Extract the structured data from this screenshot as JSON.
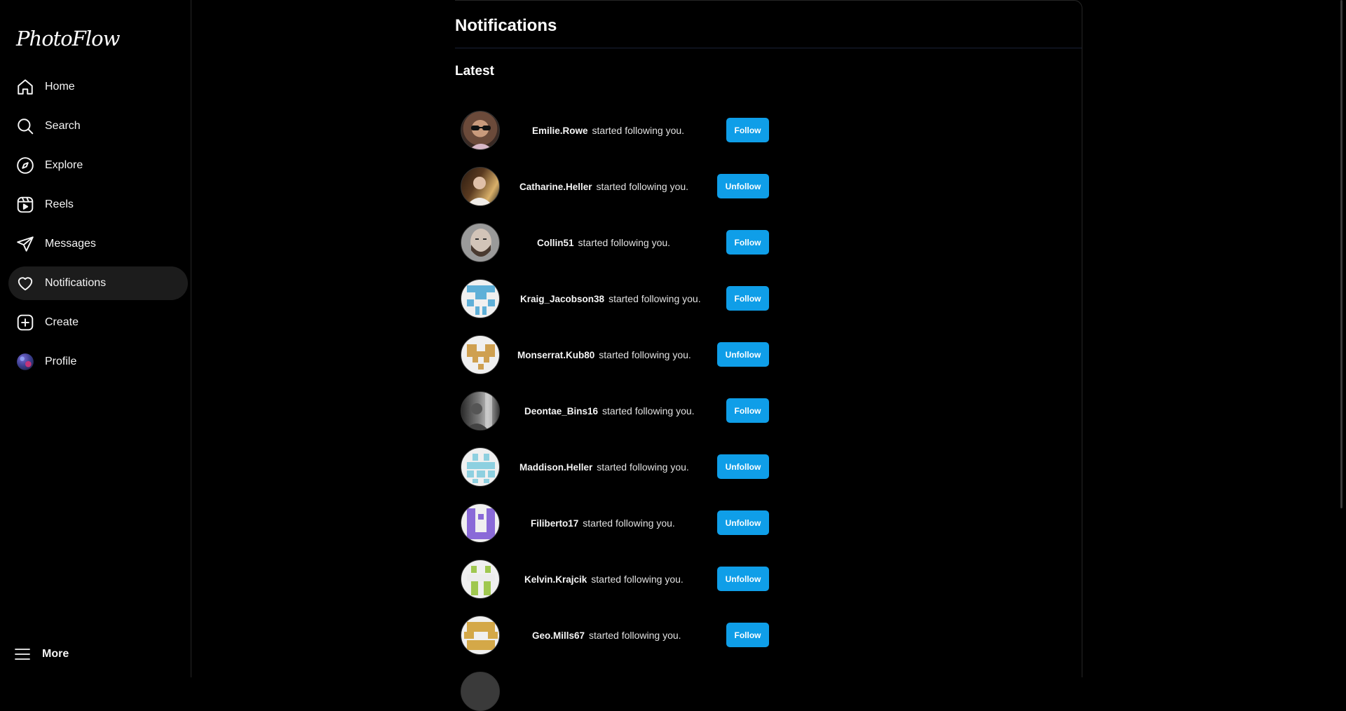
{
  "app": {
    "name": "PhotoFlow"
  },
  "sidebar": {
    "items": [
      {
        "label": "Home",
        "icon": "home-icon"
      },
      {
        "label": "Search",
        "icon": "search-icon"
      },
      {
        "label": "Explore",
        "icon": "compass-icon"
      },
      {
        "label": "Reels",
        "icon": "reels-icon"
      },
      {
        "label": "Messages",
        "icon": "send-icon"
      },
      {
        "label": "Notifications",
        "icon": "heart-icon",
        "active": true
      },
      {
        "label": "Create",
        "icon": "plus-square-icon"
      },
      {
        "label": "Profile",
        "icon": "profile-avatar"
      }
    ],
    "more_label": "More"
  },
  "main": {
    "title": "Notifications",
    "section": "Latest",
    "notifications": [
      {
        "username": "Emilie.Rowe",
        "action": "started following you.",
        "button": "Follow"
      },
      {
        "username": "Catharine.Heller",
        "action": "started following you.",
        "button": "Unfollow"
      },
      {
        "username": "Collin51",
        "action": "started following you.",
        "button": "Follow"
      },
      {
        "username": "Kraig_Jacobson38",
        "action": "started following you.",
        "button": "Follow"
      },
      {
        "username": "Monserrat.Kub80",
        "action": "started following you.",
        "button": "Unfollow"
      },
      {
        "username": "Deontae_Bins16",
        "action": "started following you.",
        "button": "Follow"
      },
      {
        "username": "Maddison.Heller",
        "action": "started following you.",
        "button": "Unfollow"
      },
      {
        "username": "Filiberto17",
        "action": "started following you.",
        "button": "Unfollow"
      },
      {
        "username": "Kelvin.Krajcik",
        "action": "started following you.",
        "button": "Unfollow"
      },
      {
        "username": "Geo.Mills67",
        "action": "started following you.",
        "button": "Follow"
      }
    ]
  },
  "colors": {
    "accent": "#0f9ee8",
    "background": "#000000",
    "active_nav": "#1c1c1c"
  }
}
